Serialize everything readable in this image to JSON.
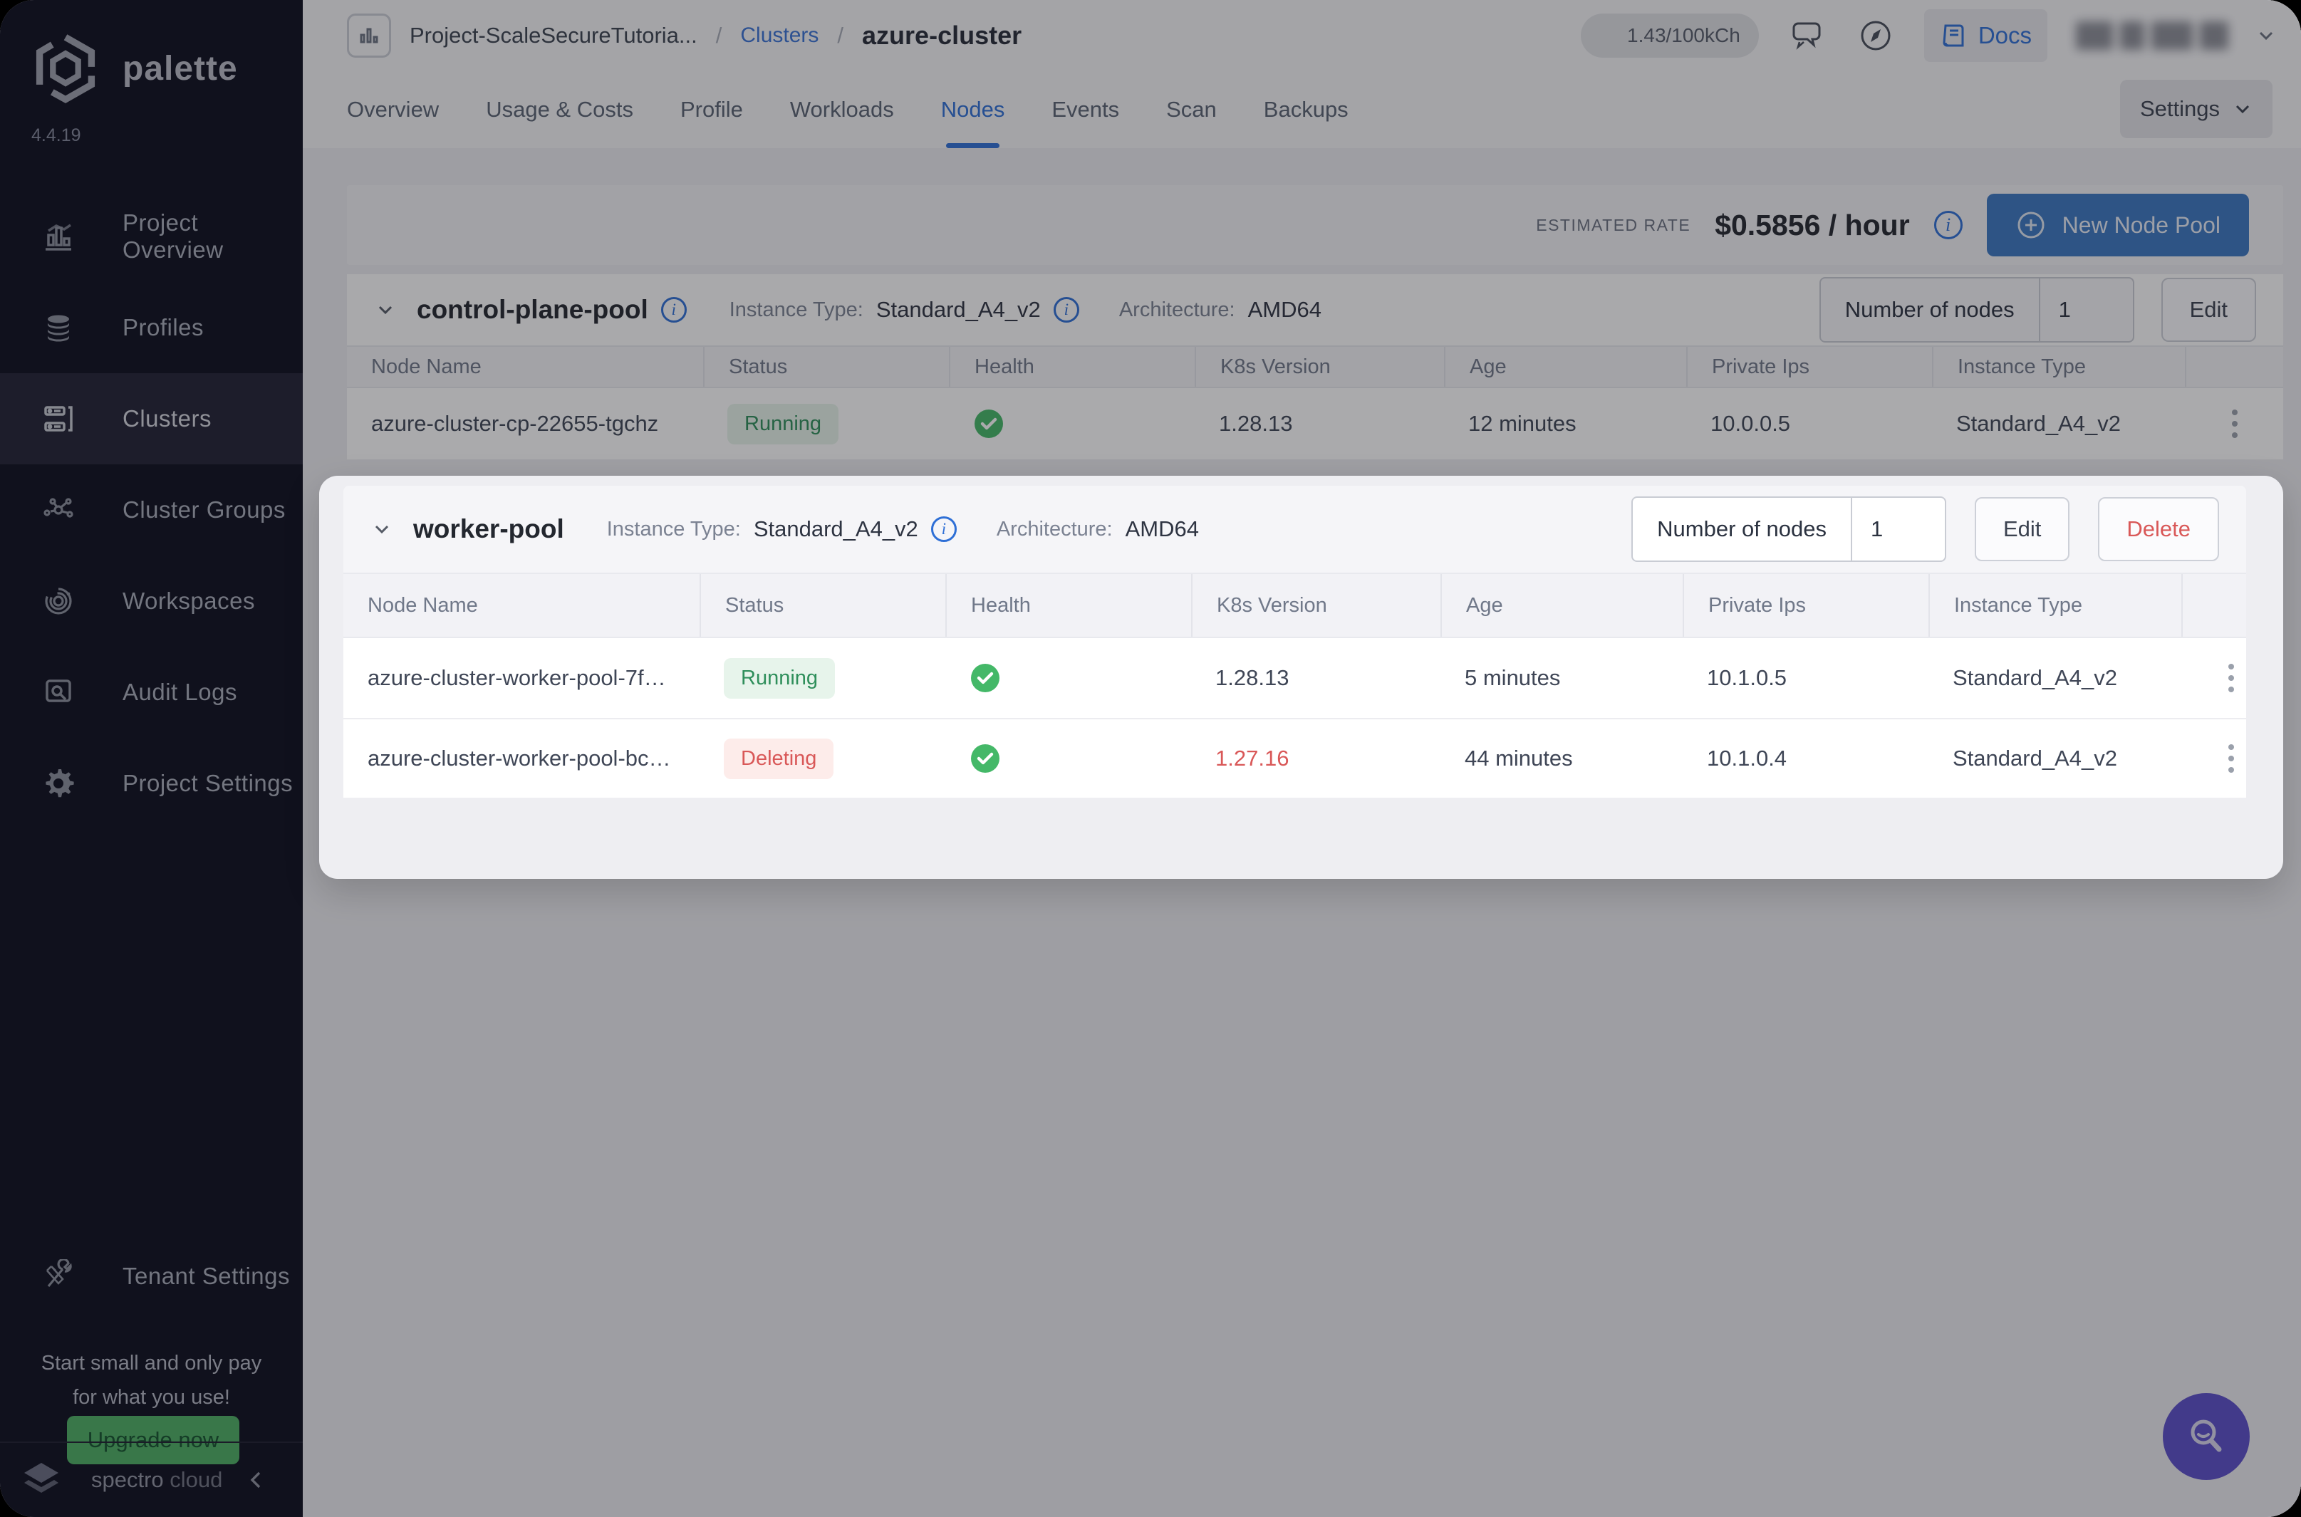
{
  "app": {
    "brand": "palette",
    "version": "4.4.19",
    "footer_brand_a": "spectro",
    "footer_brand_b": " cloud"
  },
  "sidebar": {
    "items": [
      {
        "label": "Project Overview"
      },
      {
        "label": "Profiles"
      },
      {
        "label": "Clusters"
      },
      {
        "label": "Cluster Groups"
      },
      {
        "label": "Workspaces"
      },
      {
        "label": "Audit Logs"
      },
      {
        "label": "Project Settings"
      }
    ],
    "tenant_settings_label": "Tenant Settings",
    "promo_line1": "Start small and only pay",
    "promo_line2": "for what you use!",
    "upgrade_label": "Upgrade now"
  },
  "header": {
    "project_name": "Project-ScaleSecureTutoria...",
    "separator": "/",
    "clusters_link": "Clusters",
    "cluster_name": "azure-cluster",
    "usage_badge": "1.43/100kCh",
    "docs_label": "Docs",
    "settings_label": "Settings"
  },
  "tabs": [
    {
      "label": "Overview"
    },
    {
      "label": "Usage & Costs"
    },
    {
      "label": "Profile"
    },
    {
      "label": "Workloads"
    },
    {
      "label": "Nodes"
    },
    {
      "label": "Events"
    },
    {
      "label": "Scan"
    },
    {
      "label": "Backups"
    }
  ],
  "toolbar": {
    "estimated_rate_label": "ESTIMATED RATE",
    "rate_value": "$0.5856 / hour",
    "new_node_pool_label": "New Node Pool"
  },
  "table": {
    "headers": [
      "Node Name",
      "Status",
      "Health",
      "K8s Version",
      "Age",
      "Private Ips",
      "Instance Type"
    ]
  },
  "pools": [
    {
      "name": "control-plane-pool",
      "instance_type_label": "Instance Type:",
      "instance_type": "Standard_A4_v2",
      "architecture_label": "Architecture:",
      "architecture": "AMD64",
      "nodes_label": "Number of nodes",
      "nodes_value": "1",
      "edit_label": "Edit",
      "rows": [
        {
          "name": "azure-cluster-cp-22655-tgchz",
          "status": "Running",
          "k8s": "1.28.13",
          "age": "12 minutes",
          "ip": "10.0.0.5",
          "type": "Standard_A4_v2"
        }
      ]
    },
    {
      "name": "worker-pool",
      "instance_type_label": "Instance Type:",
      "instance_type": "Standard_A4_v2",
      "architecture_label": "Architecture:",
      "architecture": "AMD64",
      "nodes_label": "Number of nodes",
      "nodes_value": "1",
      "edit_label": "Edit",
      "delete_label": "Delete",
      "rows": [
        {
          "name": "azure-cluster-worker-pool-7f…",
          "status": "Running",
          "k8s": "1.28.13",
          "age": "5 minutes",
          "ip": "10.1.0.5",
          "type": "Standard_A4_v2"
        },
        {
          "name": "azure-cluster-worker-pool-bc…",
          "status": "Deleting",
          "k8s": "1.27.16",
          "age": "44 minutes",
          "ip": "10.1.0.4",
          "type": "Standard_A4_v2"
        }
      ]
    }
  ],
  "colors": {
    "accent_blue": "#2e6fd6",
    "button_blue": "#3b77c2",
    "success_green": "#2f8f5b",
    "health_green": "#44b868",
    "danger_red": "#d95858",
    "upgrade_green": "#4cae63",
    "help_purple": "#5b4ec9",
    "sidebar_bg": "#0c0d1d"
  }
}
